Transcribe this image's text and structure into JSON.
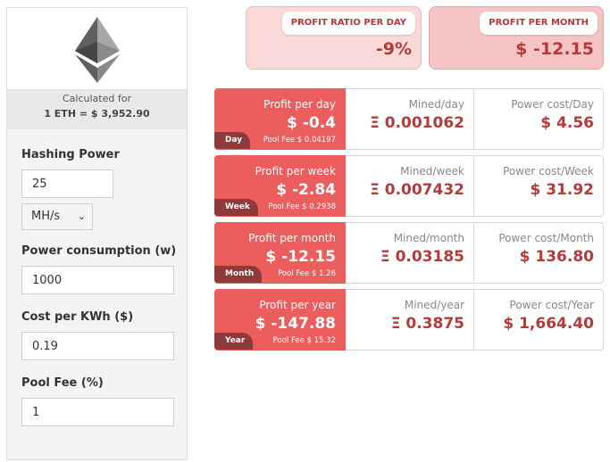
{
  "sidebar": {
    "calc_label": "Calculated for",
    "calc_rate": "1 ETH = $ 3,952.90",
    "hashing_power": {
      "label": "Hashing Power",
      "value": "25",
      "unit": "MH/s"
    },
    "power_consumption": {
      "label": "Power consumption (w)",
      "value": "1000"
    },
    "cost_per_kwh": {
      "label": "Cost per KWh ($)",
      "value": "0.19"
    },
    "pool_fee": {
      "label": "Pool Fee (%)",
      "value": "1"
    }
  },
  "summary": [
    {
      "label": "PROFIT RATIO PER DAY",
      "value": "-9%"
    },
    {
      "label": "PROFIT PER MONTH",
      "value": "$ -12.15"
    }
  ],
  "rows": [
    {
      "tag": "Day",
      "profit_label": "Profit per day",
      "profit_value": "$ -0.4",
      "pool_fee": "Pool Fee $ 0.04197",
      "mined_label": "Mined/day",
      "mined_value": "Ξ 0.001062",
      "power_label": "Power cost/Day",
      "power_value": "$ 4.56"
    },
    {
      "tag": "Week",
      "profit_label": "Profit per week",
      "profit_value": "$ -2.84",
      "pool_fee": "Pool Fee $ 0.2938",
      "mined_label": "Mined/week",
      "mined_value": "Ξ 0.007432",
      "power_label": "Power cost/Week",
      "power_value": "$ 31.92"
    },
    {
      "tag": "Month",
      "profit_label": "Profit per month",
      "profit_value": "$ -12.15",
      "pool_fee": "Pool Fee $ 1.26",
      "mined_label": "Mined/month",
      "mined_value": "Ξ 0.03185",
      "power_label": "Power cost/Month",
      "power_value": "$ 136.80"
    },
    {
      "tag": "Year",
      "profit_label": "Profit per year",
      "profit_value": "$ -147.88",
      "pool_fee": "Pool Fee $ 15.32",
      "mined_label": "Mined/year",
      "mined_value": "Ξ 0.3875",
      "power_label": "Power cost/Year",
      "power_value": "$ 1,664.40"
    }
  ],
  "icons": {
    "logo": "ethereum-logo-icon",
    "select": "chevron-down-icon"
  },
  "colors": {
    "accent": "#ec5d5d",
    "tag": "#8f3a3a",
    "value_text": "#b53a3a",
    "summary_bg": "#fbd9d9"
  }
}
